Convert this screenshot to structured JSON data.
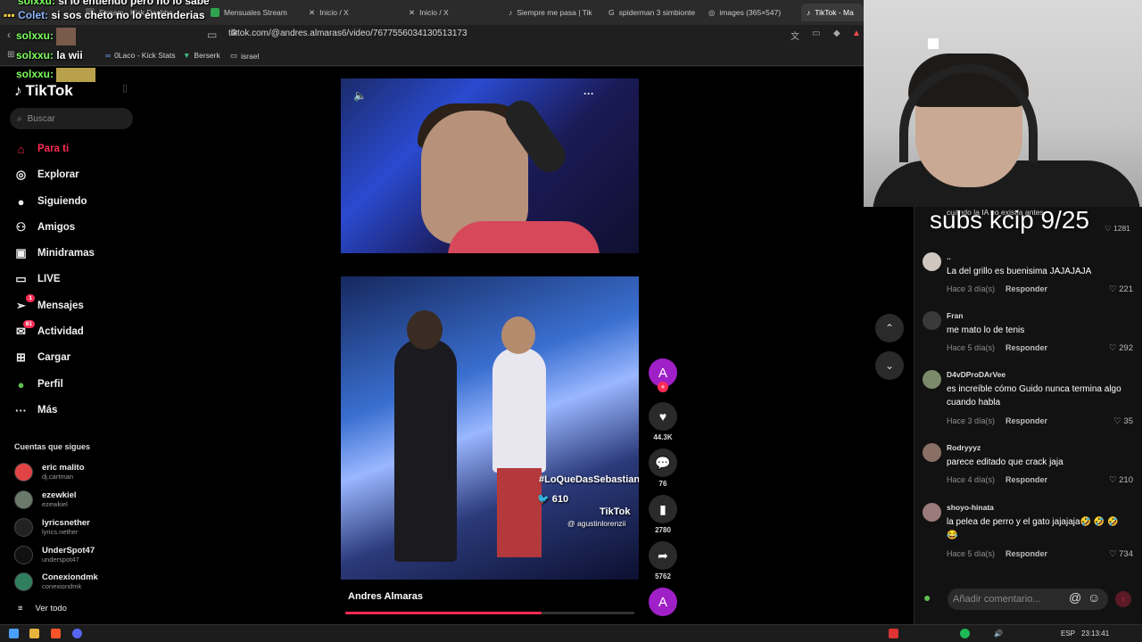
{
  "browser": {
    "tabs": [
      {
        "label": "Stream - Kick Dashbo"
      },
      {
        "label": "Mensuales Stream"
      },
      {
        "label": "Inicio / X"
      },
      {
        "label": "Inicio / X"
      },
      {
        "label": "Siempre me pasa | Tik"
      },
      {
        "label": "spiderman 3 simbionte"
      },
      {
        "label": "images (365×547)"
      },
      {
        "label": "TikTok - Ma"
      }
    ],
    "url": "tiktok.com/@andres.almaras6/video/7677556034130513173",
    "bookmarks": [
      "0Laco - Kick Stats",
      "Berserk",
      "israel"
    ]
  },
  "stream_chat": [
    {
      "user": "solxxu:",
      "message": "si lo entiendo pero no lo sabe"
    },
    {
      "user": "Colet:",
      "message": "si sos cheto no lo entenderias"
    },
    {
      "user": "solxxu:",
      "message": ""
    },
    {
      "user": "solxxu:",
      "message": "la wii"
    },
    {
      "user": "solxxu:",
      "message": ""
    }
  ],
  "tiktok": {
    "logo": "TikTok",
    "search_placeholder": "Buscar",
    "nav": [
      {
        "label": "Para ti",
        "icon": "home-icon"
      },
      {
        "label": "Explorar",
        "icon": "compass-icon"
      },
      {
        "label": "Siguiendo",
        "icon": "avatar-icon"
      },
      {
        "label": "Amigos",
        "icon": "people-icon"
      },
      {
        "label": "Minidramas",
        "icon": "tv-icon"
      },
      {
        "label": "LIVE",
        "icon": "live-icon"
      },
      {
        "label": "Mensajes",
        "icon": "paper-plane-icon",
        "badge": "1"
      },
      {
        "label": "Actividad",
        "icon": "inbox-icon",
        "badge": "81"
      },
      {
        "label": "Cargar",
        "icon": "plus-square-icon"
      },
      {
        "label": "Perfil",
        "icon": "profile-icon"
      },
      {
        "label": "Más",
        "icon": "more-icon"
      }
    ],
    "following_title": "Cuentas que sigues",
    "following": [
      {
        "name": "eric malito",
        "handle": "dj.cartman"
      },
      {
        "name": "ezewkiel",
        "handle": "ezewkiel"
      },
      {
        "name": "lyricsnether",
        "handle": "lyrics.nether"
      },
      {
        "name": "UnderSpot47",
        "handle": "underspot47"
      },
      {
        "name": "Conexiondmk",
        "handle": "conexiondmk"
      }
    ],
    "see_all": "Ver todo",
    "video": {
      "author": "Andres Almaras",
      "author_initial": "A",
      "overlay_hashtag": "#LoQueDasSebastian",
      "overlay_twitter": "610",
      "overlay_brand": "TikTok",
      "overlay_user": "@ agustinlorenzii",
      "progress": 0.68
    },
    "actions": [
      {
        "icon": "heart-icon",
        "count": "44.3K"
      },
      {
        "icon": "comment-icon",
        "count": "76"
      },
      {
        "icon": "bookmark-icon",
        "count": "2780"
      },
      {
        "icon": "share-icon",
        "count": "5762"
      }
    ],
    "comments": {
      "overlay_text": "subs kcip 9/25",
      "top_partial": {
        "text": "cuándo la IA no existía antes",
        "likes": "1281"
      },
      "items": [
        {
          "user": "..",
          "text": "La del grillo es buenisima JAJAJAJA",
          "time": "Hace 3 día(s)",
          "likes": "221"
        },
        {
          "user": "Fran",
          "text": "me mato lo de tenis",
          "time": "Hace 5 día(s)",
          "likes": "292"
        },
        {
          "user": "D4vDProDArVee",
          "text": "es increíble cómo Guido nunca termina algo cuando habla",
          "time": "Hace 3 día(s)",
          "likes": "35"
        },
        {
          "user": "Rodryyyz",
          "text": "parece editado que crack jaja",
          "time": "Hace 4 día(s)",
          "likes": "210"
        },
        {
          "user": "shoyo-hinata",
          "text": "la pelea de perro y el gato jajajaja🤣 🤣 🤣 😂",
          "time": "Hace 5 día(s)",
          "likes": "734"
        }
      ],
      "reply_label": "Responder",
      "input_placeholder": "Añadir comentario..."
    }
  },
  "taskbar": {
    "lang": "ESP",
    "clock": "23:13:41"
  },
  "colors": {
    "accent": "#fe2c55",
    "author_avatar": "#a020c8"
  }
}
